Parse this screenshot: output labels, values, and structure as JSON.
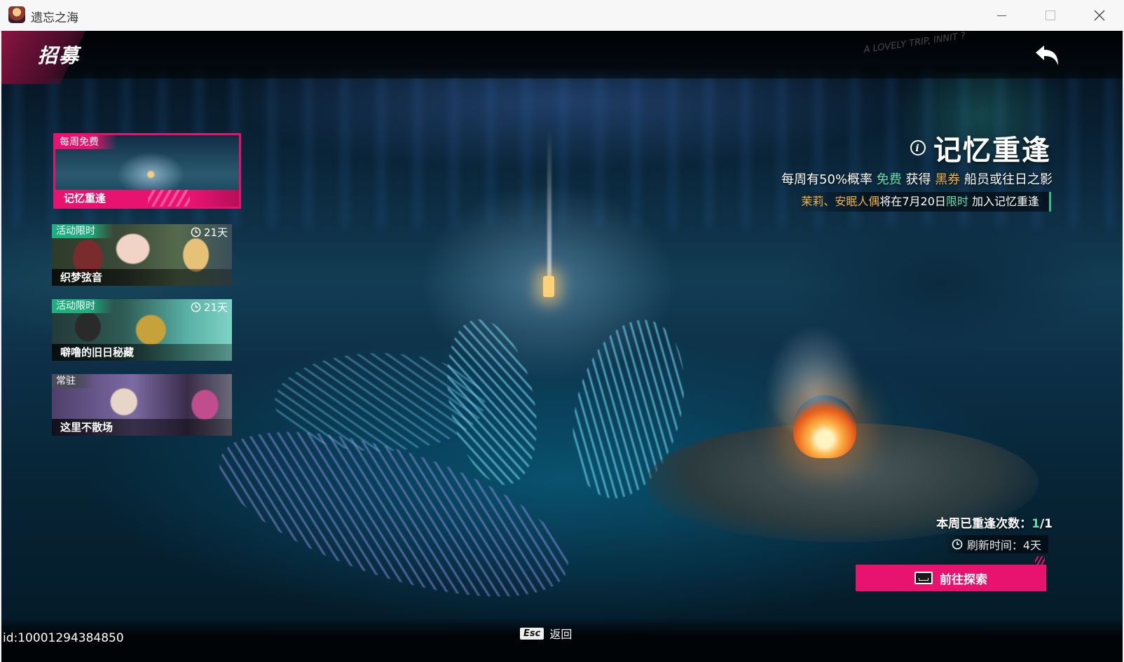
{
  "window": {
    "title": "遗忘之海",
    "icon": "app-icon"
  },
  "header": {
    "title": "招募",
    "graffiti": "A LOVELY TRIP, INNIT ?",
    "back_icon": "back-arrow-icon"
  },
  "banners": [
    {
      "tag": "每周免费",
      "name": "记忆重逢",
      "timer": "",
      "selected": true
    },
    {
      "tag": "活动限时",
      "name": "织梦弦音",
      "timer": "21天",
      "selected": false
    },
    {
      "tag": "活动限时",
      "name": "噼噜的旧日秘藏",
      "timer": "21天",
      "selected": false
    },
    {
      "tag": "常驻",
      "name": "这里不散场",
      "timer": "",
      "selected": false
    }
  ],
  "detail": {
    "title": "记忆重逢",
    "desc_prefix": "每周有50%概率",
    "desc_free": "免费",
    "desc_mid": "获得",
    "desc_ticket": "黑券",
    "desc_suffix": "船员或往日之影",
    "notice_names": "茉莉、安眠人偶",
    "notice_mid": "将在7月20日",
    "notice_limit": "限时",
    "notice_suffix": "加入记忆重逢",
    "weekly_label": "本周已重逢次数：",
    "weekly_used": "1",
    "weekly_total": "/1",
    "refresh_label": "刷新时间：4天",
    "explore_button": "前往探索"
  },
  "footer": {
    "esc_key": "Esc",
    "esc_label": "返回",
    "player_id": "id:10001294384850"
  },
  "colors": {
    "accent_pink": "#e8136f",
    "accent_green": "#1fae7d",
    "highlight_gold": "#f0b24a",
    "highlight_teal": "#5fe0b0"
  }
}
